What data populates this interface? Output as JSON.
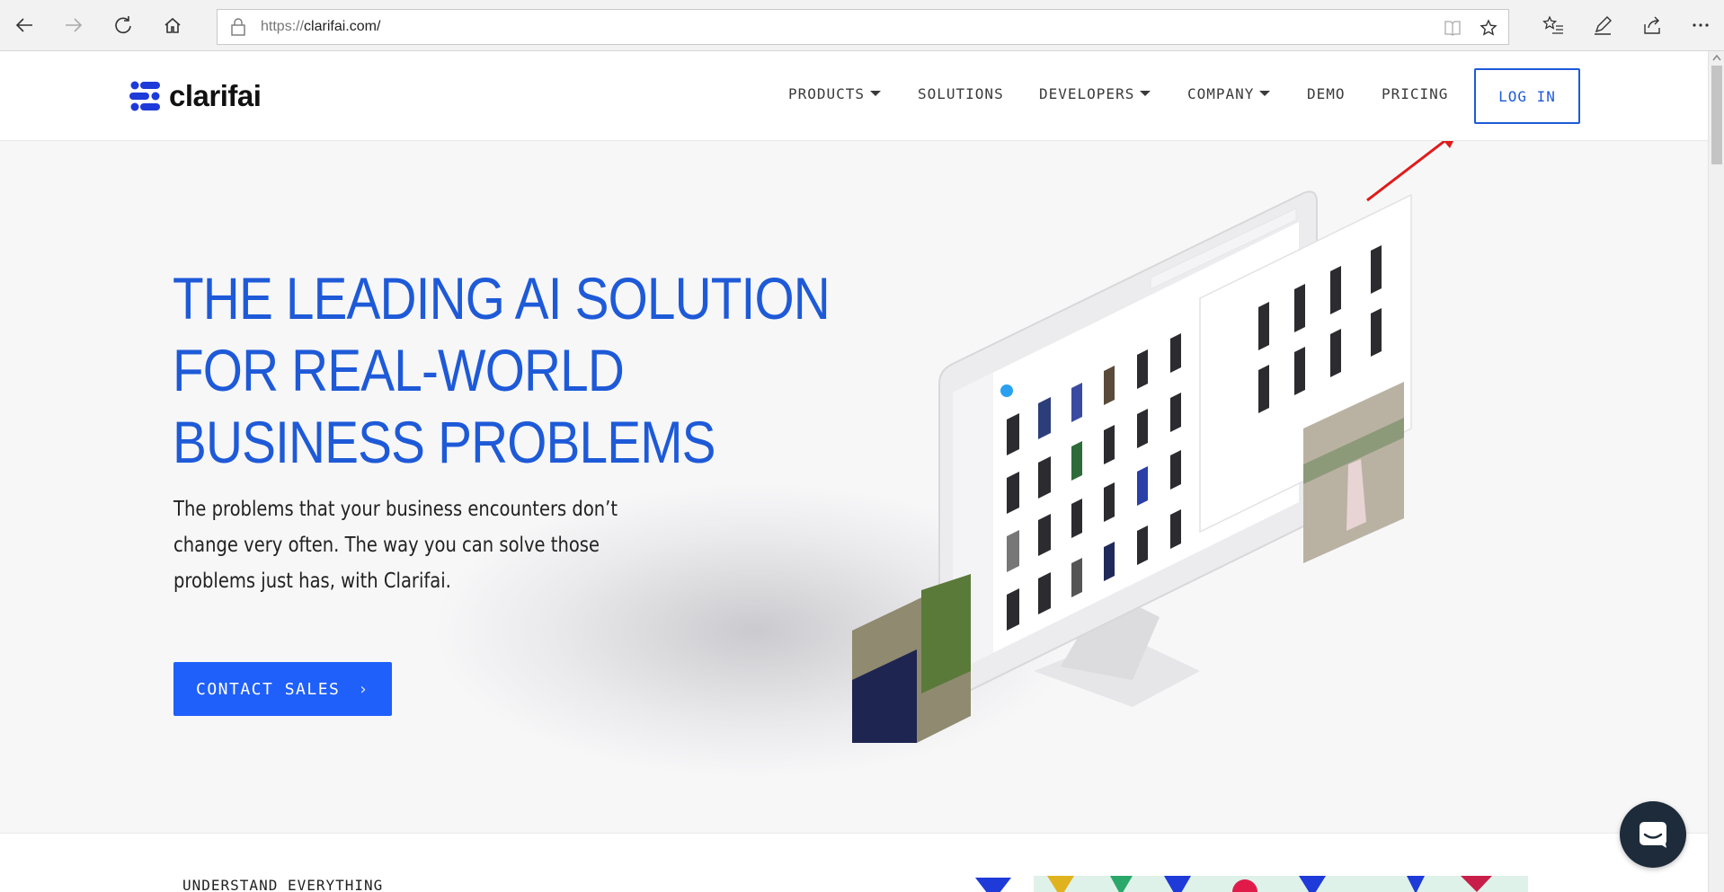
{
  "browser": {
    "url_scheme": "https://",
    "url_host": "clarifai.com/"
  },
  "site": {
    "logo_text": "clarifai",
    "nav": [
      {
        "label": "PRODUCTS",
        "dropdown": true
      },
      {
        "label": "SOLUTIONS",
        "dropdown": false
      },
      {
        "label": "DEVELOPERS",
        "dropdown": true
      },
      {
        "label": "COMPANY",
        "dropdown": true
      },
      {
        "label": "DEMO",
        "dropdown": false
      },
      {
        "label": "PRICING",
        "dropdown": false
      }
    ],
    "login_label": "LOG IN"
  },
  "hero": {
    "headline_lines": [
      "THE LEADING AI SOLUTION",
      "FOR REAL-WORLD",
      "BUSINESS PROBLEMS"
    ],
    "subtext": "The problems that your business encounters don’t change very often. The way you can solve those problems just has, with Clarifai.",
    "cta_label": "CONTACT SALES"
  },
  "next_section": {
    "label": "UNDERSTAND EVERYTHING"
  },
  "colors": {
    "brand_blue": "#1e5ad8",
    "cta_blue": "#1f5ffa",
    "annotation_red": "#e01b1b",
    "chat_bg": "#1d2b3a"
  }
}
